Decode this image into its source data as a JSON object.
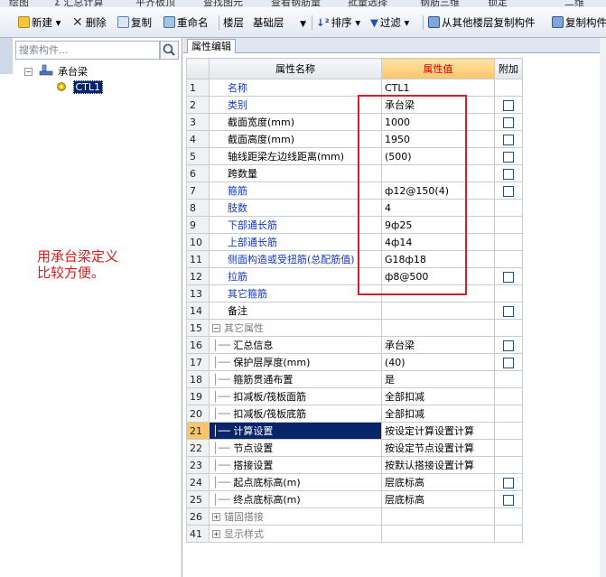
{
  "topstrip": {
    "items": [
      "绘图",
      "Σ 汇总计算",
      "平齐板顶",
      "查找图元",
      "查看钢筋量",
      "批量选择",
      "钢筋三维",
      "锁定",
      "二维"
    ]
  },
  "toolbar": {
    "new_label": "新建",
    "delete_label": "删除",
    "copy_label": "复制",
    "rename_label": "重命名",
    "floor_label": "楼层",
    "floor_value": "基础层",
    "sort_label": "排序",
    "filter_label": "过滤",
    "copy_from_floor_label": "从其他楼层复制构件",
    "copy_component_label": "复制构件"
  },
  "left": {
    "search_placeholder": "搜索构件...",
    "tree_root": "承台梁",
    "tree_child": "CTL1",
    "note": "用承台梁定义\n比较方便。"
  },
  "right": {
    "tab_label": "属性编辑",
    "headers": {
      "name": "属性名称",
      "value": "属性值",
      "extra": "附加"
    },
    "rows": [
      {
        "no": "1",
        "name": "名称",
        "value": "CTL1",
        "style": "blue",
        "check": false
      },
      {
        "no": "2",
        "name": "类别",
        "value": "承台梁",
        "style": "blue",
        "check": true
      },
      {
        "no": "3",
        "name": "截面宽度(mm)",
        "value": "1000",
        "style": "black",
        "check": true
      },
      {
        "no": "4",
        "name": "截面高度(mm)",
        "value": "1950",
        "style": "black",
        "check": true
      },
      {
        "no": "5",
        "name": "轴线距梁左边线距离(mm)",
        "value": "(500)",
        "style": "black",
        "check": true
      },
      {
        "no": "6",
        "name": "跨数量",
        "value": "",
        "style": "black",
        "check": true
      },
      {
        "no": "7",
        "name": "箍筋",
        "value": "ф12@150(4)",
        "style": "blue",
        "check": true
      },
      {
        "no": "8",
        "name": "肢数",
        "value": "4",
        "style": "blue",
        "check": false
      },
      {
        "no": "9",
        "name": "下部通长筋",
        "value": "9ф25",
        "style": "blue",
        "check": false
      },
      {
        "no": "10",
        "name": "上部通长筋",
        "value": "4ф14",
        "style": "blue",
        "check": false
      },
      {
        "no": "11",
        "name": "侧面构造或受扭筋(总配筋值)",
        "value": "G18ф18",
        "style": "blue",
        "check": false
      },
      {
        "no": "12",
        "name": "拉筋",
        "value": "ф8@500",
        "style": "blue",
        "check": true
      },
      {
        "no": "13",
        "name": "其它箍筋",
        "value": "",
        "style": "blue",
        "check": false
      },
      {
        "no": "14",
        "name": "备注",
        "value": "",
        "style": "black",
        "check": true
      },
      {
        "no": "15",
        "name": "其它属性",
        "value": "",
        "style": "group",
        "check": false
      },
      {
        "no": "16",
        "name": "汇总信息",
        "value": "承台梁",
        "style": "child",
        "check": true
      },
      {
        "no": "17",
        "name": "保护层厚度(mm)",
        "value": "(40)",
        "style": "child",
        "check": true
      },
      {
        "no": "18",
        "name": "箍筋贯通布置",
        "value": "是",
        "style": "child",
        "check": false
      },
      {
        "no": "19",
        "name": "扣减板/筏板面筋",
        "value": "全部扣减",
        "style": "child",
        "check": false
      },
      {
        "no": "20",
        "name": "扣减板/筏板底筋",
        "value": "全部扣减",
        "style": "child",
        "check": false
      },
      {
        "no": "21",
        "name": "计算设置",
        "value": "按设定计算设置计算",
        "style": "child-sel",
        "check": false
      },
      {
        "no": "22",
        "name": "节点设置",
        "value": "按设定节点设置计算",
        "style": "child",
        "check": false
      },
      {
        "no": "23",
        "name": "搭接设置",
        "value": "按默认搭接设置计算",
        "style": "child",
        "check": false
      },
      {
        "no": "24",
        "name": "起点底标高(m)",
        "value": "层底标高",
        "style": "child",
        "check": true
      },
      {
        "no": "25",
        "name": "终点底标高(m)",
        "value": "层底标高",
        "style": "child",
        "check": true
      },
      {
        "no": "26",
        "name": "锚固搭接",
        "value": "",
        "style": "group",
        "check": false
      },
      {
        "no": "41",
        "name": "显示样式",
        "value": "",
        "style": "group",
        "check": false
      }
    ]
  },
  "colors": {
    "highlight_box": "#e11a2a",
    "link_blue": "#1538c4",
    "note_red": "#d81c1c",
    "value_header": "#f9c56a"
  }
}
